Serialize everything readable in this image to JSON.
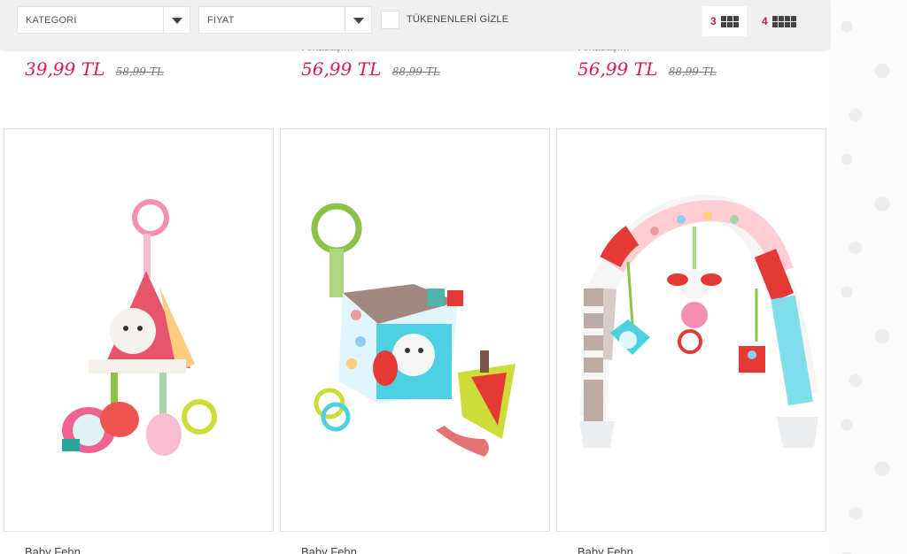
{
  "filters": {
    "category_label": "KATEGORİ",
    "price_label": "FİYAT",
    "hide_out_of_stock_label": "TÜKENENLERİ GİZLE",
    "grid3_label": "3",
    "grid4_label": "4"
  },
  "top_products": [
    {
      "title_fragment": "",
      "price": "39,99 TL",
      "old_price": "58,99 TL"
    },
    {
      "title_fragment": "Arkadaşım",
      "price": "56,99 TL",
      "old_price": "88,99 TL"
    },
    {
      "title_fragment": "Arkadaşım",
      "price": "56,99 TL",
      "old_price": "88,99 TL"
    }
  ],
  "products": [
    {
      "brand": "Baby Fehn"
    },
    {
      "brand": "Baby Fehn"
    },
    {
      "brand": "Baby Fehn"
    }
  ],
  "colors": {
    "accent": "#d81b60",
    "bar_bg": "#f0f0f0"
  }
}
